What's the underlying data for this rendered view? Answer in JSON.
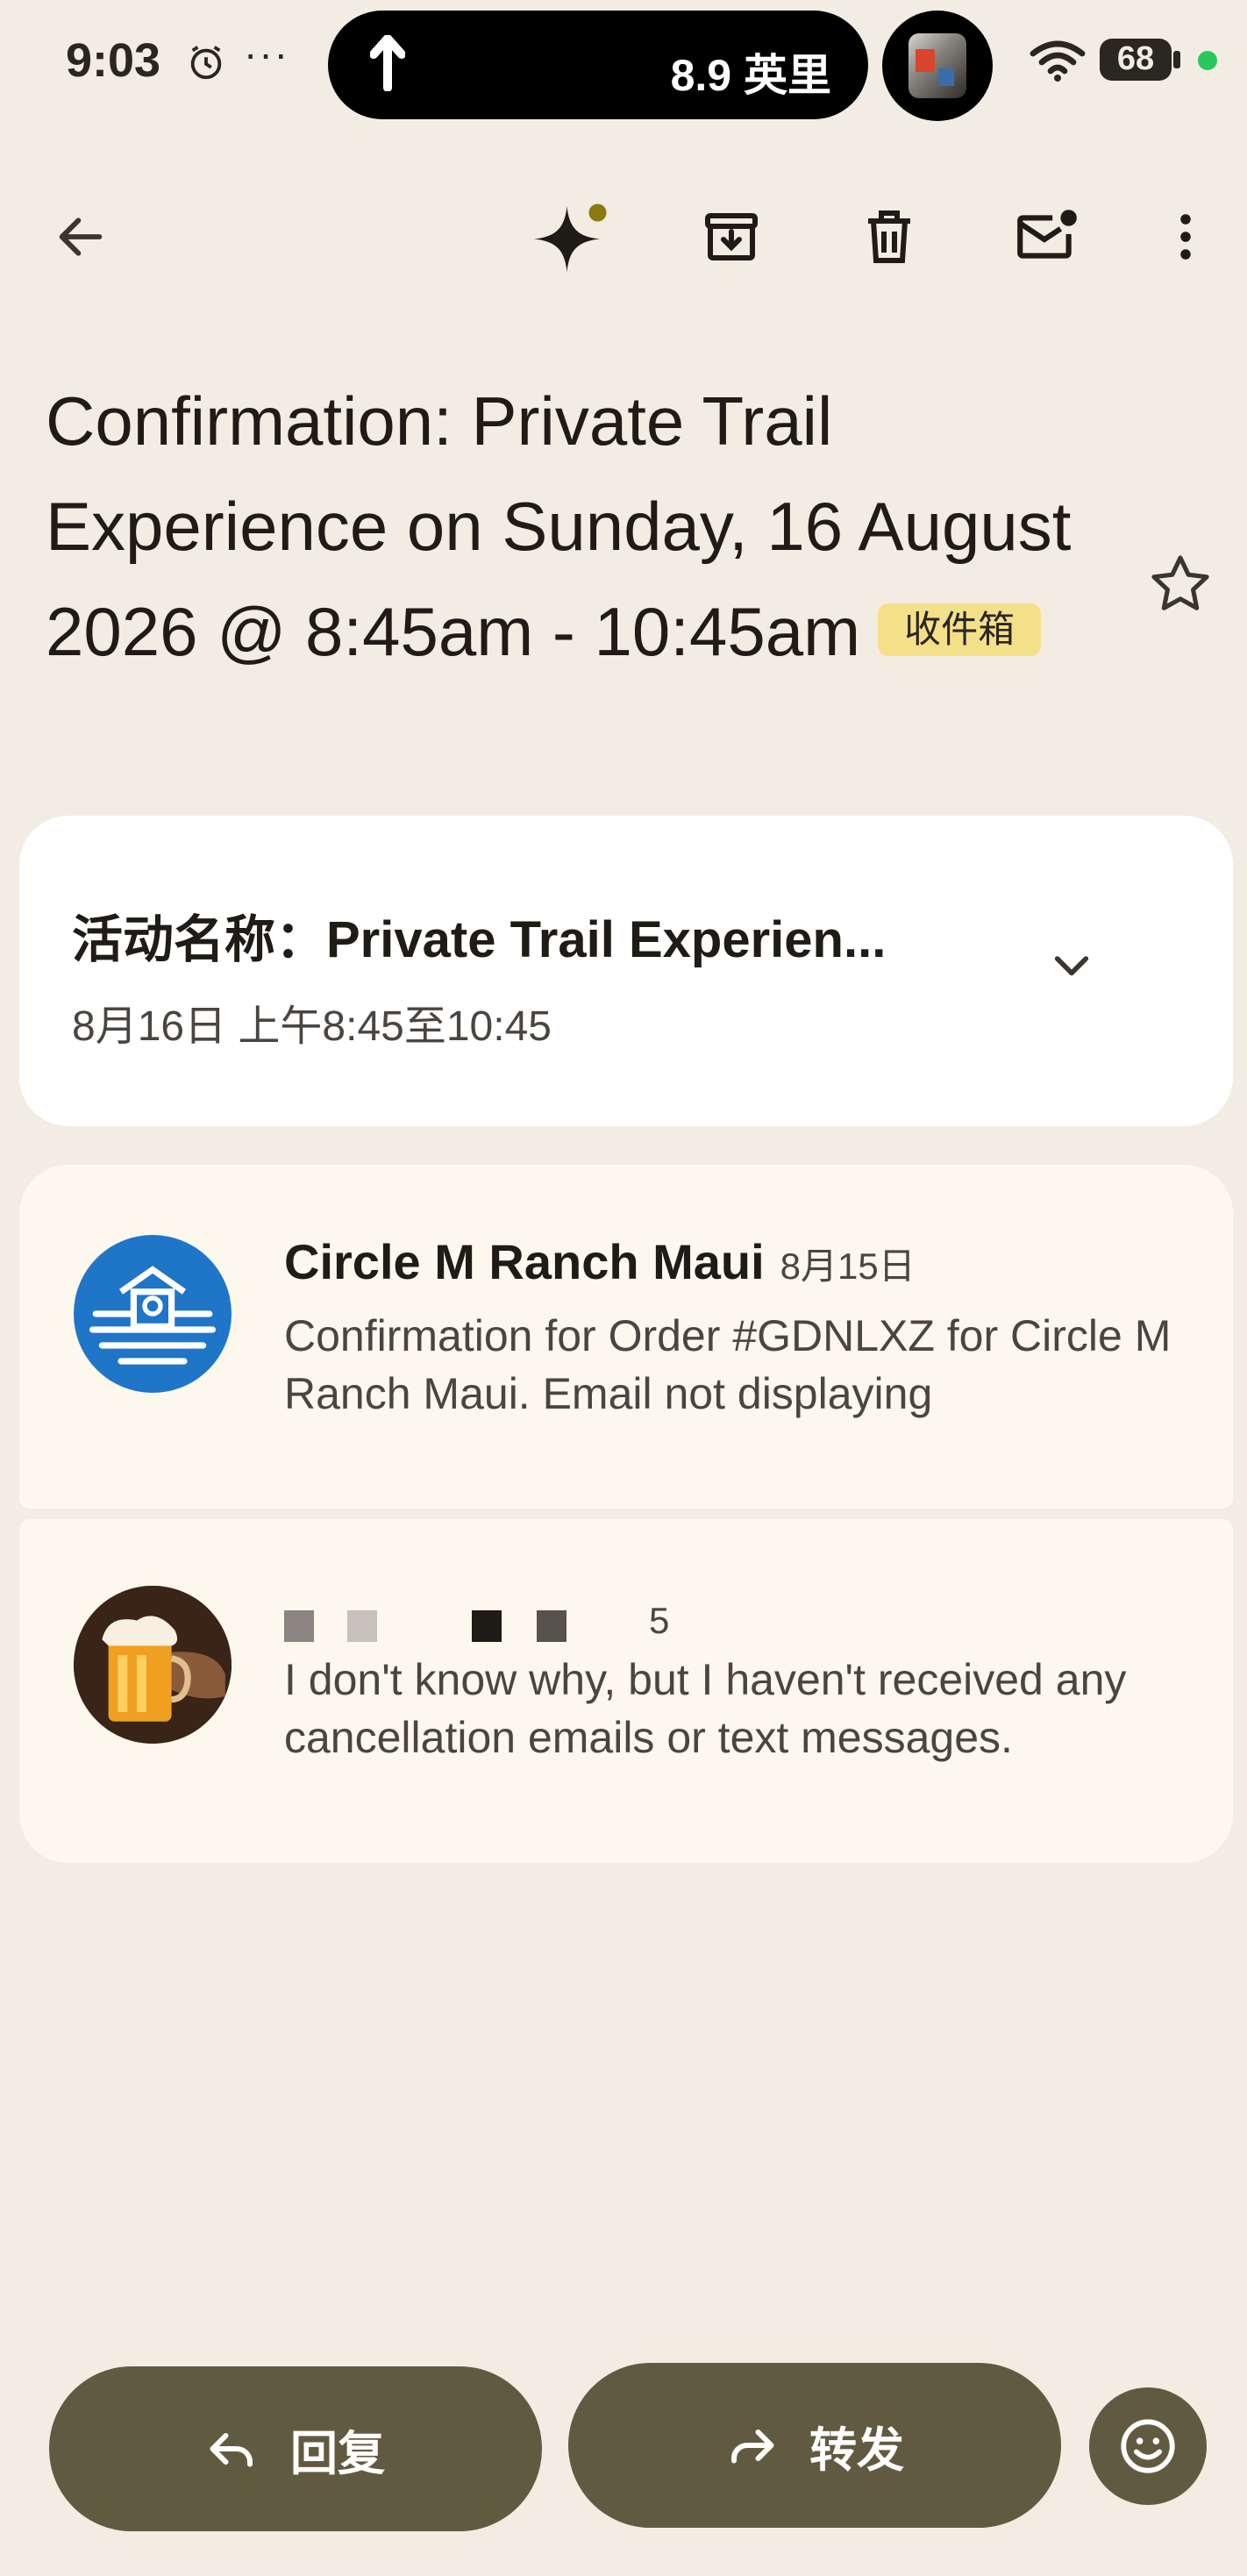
{
  "status_bar": {
    "time": "9:03",
    "dots": "···",
    "nav_distance": "8.9 英里",
    "battery_level": "68"
  },
  "toolbar": {
    "icons": [
      "back-arrow-icon",
      "gemini-sparkle-icon",
      "archive-icon",
      "delete-icon",
      "mark-unread-icon",
      "more-vert-icon"
    ]
  },
  "email": {
    "subject": "Confirmation: Private Trail Experience on Sunday, 16 August 2026 @ 8:45am - 10:45am",
    "label": "收件箱"
  },
  "event_card": {
    "title": "活动名称：Private Trail Experien...",
    "time": "8月16日 上午8:45至10:45"
  },
  "messages": [
    {
      "sender": "Circle M Ranch Maui",
      "date": "8月15日",
      "snippet": "Confirmation for Order #GDNLXZ for Circle M Ranch Maui. Email not displaying"
    },
    {
      "sender_fragment": "5",
      "snippet": "I don't know why, but I haven't received any cancellation emails or text messages."
    }
  ],
  "actions": {
    "reply": "回复",
    "forward": "转发"
  },
  "colors": {
    "background": "#f3ece2",
    "button": "#625a40",
    "label_chip": "#f5e08a",
    "avatar_blue": "#1f75c8"
  }
}
